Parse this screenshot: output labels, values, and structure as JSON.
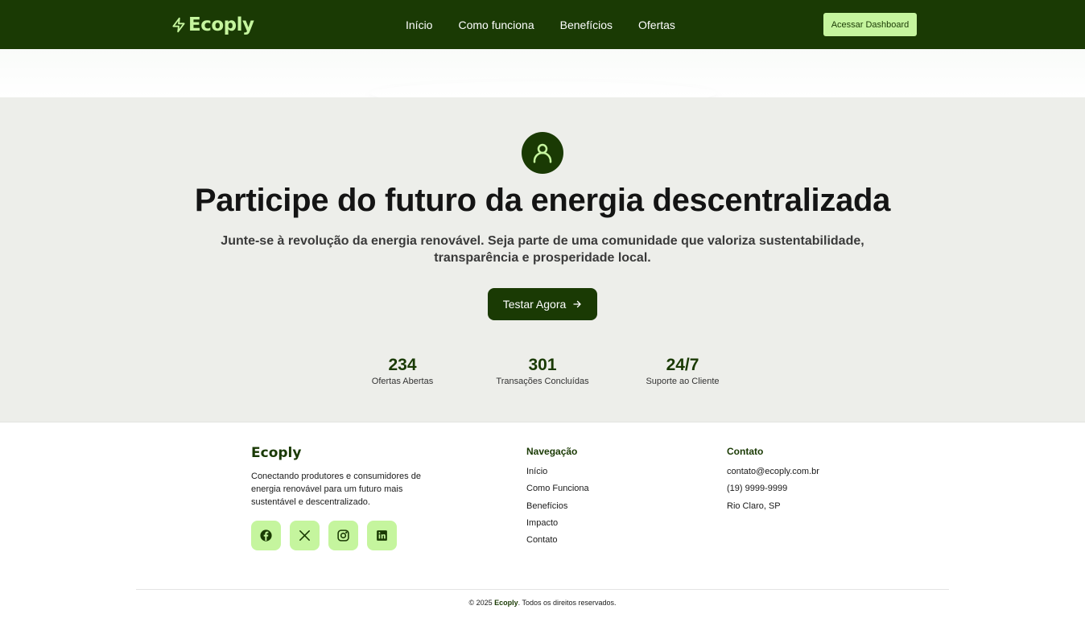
{
  "brand": {
    "name": "Ecoply"
  },
  "colors": {
    "primary": "#1a3a04",
    "accent": "#c5f59e",
    "section_bg": "#edeeea"
  },
  "nav": {
    "links": [
      "Início",
      "Como funciona",
      "Benefícios",
      "Ofertas"
    ],
    "dashboard_button": "Acessar Dashboard"
  },
  "cta": {
    "icon": "user-icon",
    "title": "Participe do futuro da energia descentralizada",
    "subtitle": "Junte-se à revolução da energia renovável. Seja parte de uma comunidade que valoriza sustentabilidade, transparência e prosperidade local.",
    "button_label": "Testar Agora",
    "stats": [
      {
        "value": "234",
        "label": "Ofertas Abertas"
      },
      {
        "value": "301",
        "label": "Transações Concluídas"
      },
      {
        "value": "24/7",
        "label": "Suporte ao Cliente"
      }
    ]
  },
  "footer": {
    "brand": "Ecoply",
    "description": "Conectando produtores e consumidores de energia renovável para um futuro mais sustentável e descentralizado.",
    "socials": [
      "facebook-icon",
      "x-icon",
      "instagram-icon",
      "linkedin-icon"
    ],
    "navigation": {
      "heading": "Navegação",
      "items": [
        "Início",
        "Como Funciona",
        "Benefícios",
        "Impacto",
        "Contato"
      ]
    },
    "contact": {
      "heading": "Contato",
      "items": [
        "contato@ecoply.com.br",
        "(19) 9999-9999",
        "Rio Claro, SP"
      ]
    },
    "copyright": {
      "prefix": "© 2025",
      "brand": "Ecoply",
      "suffix": ". Todos os direitos reservados."
    }
  }
}
